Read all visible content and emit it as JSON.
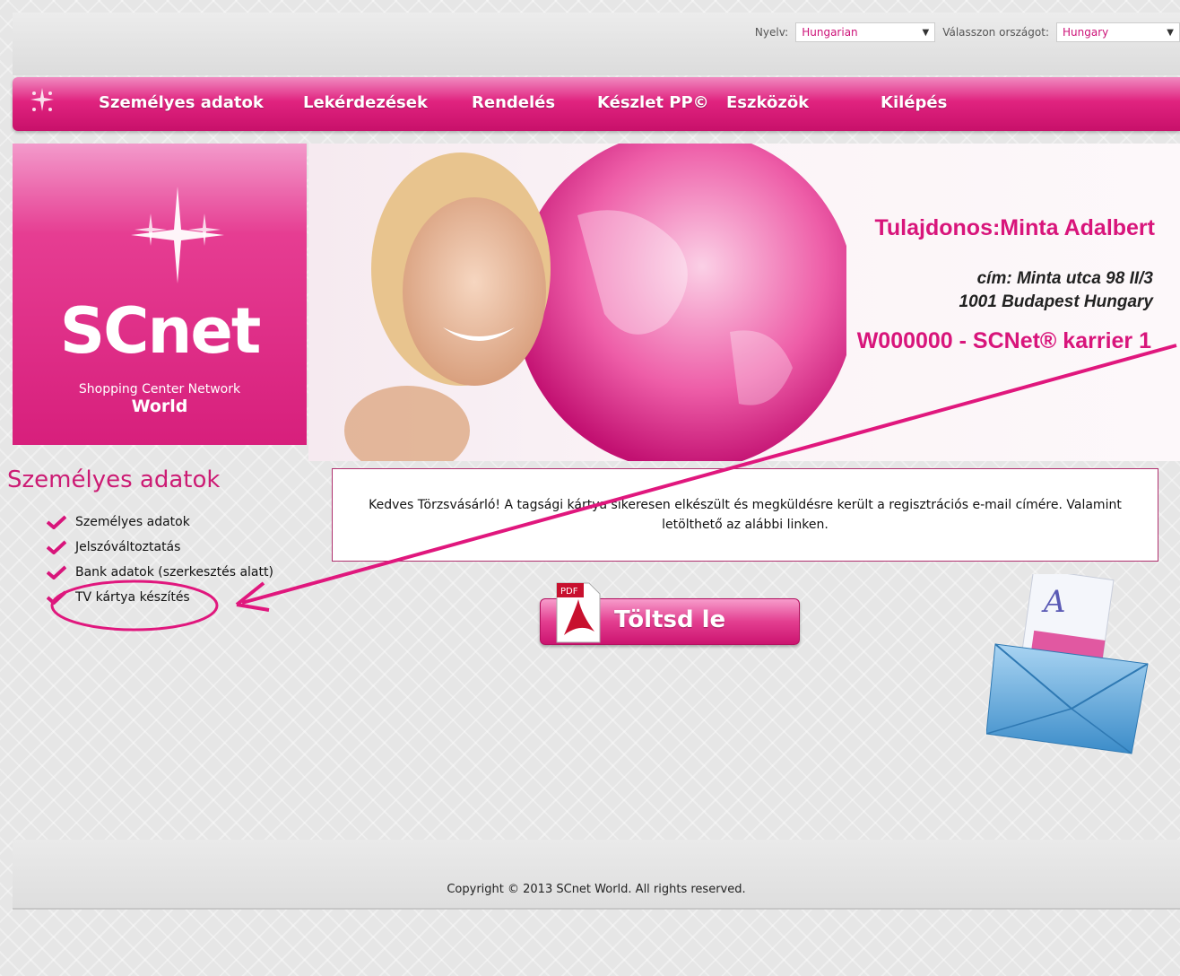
{
  "header": {
    "language_label": "Nyelv:",
    "language_value": "Hungarian",
    "country_label": "Válasszon országot:",
    "country_value": "Hungary"
  },
  "nav": {
    "items": [
      "Személyes adatok",
      "Lekérdezések",
      "Rendelés",
      "Készlet PP©",
      "Eszközök",
      "Kilépés"
    ]
  },
  "logo": {
    "name": "SCnet",
    "subtitle": "Shopping Center Network",
    "world": "World"
  },
  "banner": {
    "owner": "Tulajdonos:Minta Adalbert",
    "address_line1": "cím: Minta utca 98 II/3",
    "address_line2": "1001 Budapest Hungary",
    "career": "W000000 - SCNet® karrier 1"
  },
  "sidebar": {
    "title": "Személyes adatok",
    "items": [
      "Személyes adatok",
      "Jelszóváltoztatás",
      "Bank adatok (szerkesztés alatt)",
      "TV kártya készítés"
    ]
  },
  "notice": "Kedves Törzsvásárló! A tagsági kártya sikeresen elkészült és megküldésre került a regisztrációs e-mail címére. Valamint letölthető az alábbi linken.",
  "download": {
    "label": "Töltsd le",
    "icon": "pdf-icon"
  },
  "footer": {
    "copyright": "Copyright © 2013 SCnet World. All rights reserved."
  },
  "colors": {
    "accent": "#d8157b",
    "nav": "#e0237f"
  }
}
